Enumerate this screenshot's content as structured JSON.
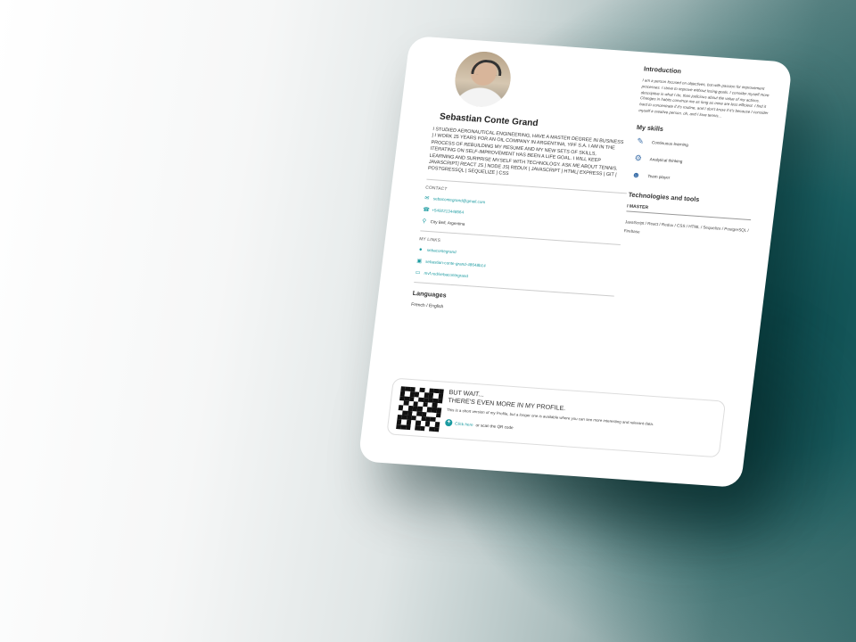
{
  "profile": {
    "name": "Sebastian Conte Grand",
    "bio": "I STUDIED AERONAUTICAL ENGINEERING, HAVE A MASTER DEGREE IN BUSINESS | I WORK 25 YEARS FOR AN OIL COMPANY IN ARGENTINA, YPF S.A. I AM IN THE PROCESS OF REBUILDING MY RESUME AND MY NEW SETS OF SKILLS, ITERATING ON SELF-IMPROVEMENT HAS BEEN A LIFE GOAL. I WILL KEEP LEARNING AND SURPRISE MYSELF WITH TECHNOLOGY. ASK ME ABOUT TENNIS. JAVASCRIPT| REACT JS | NODE JS| REDUX | JAVASCRIPT | HTML| EXPRESS | GIT | POSTGRESSQL | SEQUELIZE | CSS"
  },
  "contact": {
    "label": "CONTACT",
    "email": "sebacontegrand@gmail.com",
    "phone": "+5492213448564",
    "location": "City Bell, Argentina"
  },
  "links": {
    "label": "MY LINKS",
    "github": "sebacontegrand",
    "linkedin": "sebastian-conte-grand-48648b14",
    "other": "mvf.red/sebacontegrand"
  },
  "languages": {
    "title": "Languages",
    "list": "French / English"
  },
  "intro": {
    "title": "Introduction",
    "text": "I am a person focused on objectives, but with passion for improvement processes. I strive to improve without losing goals. I consider myself more descriptive in what I do, than judicious about the value of my actions. Changes in habits convince me as long as mine are less efficient. I find it hard to concentrate if it's routine, and I don't know if it's because I consider myself a creative person. oh, and I love tennis..."
  },
  "skills": {
    "title": "My skills",
    "items": [
      {
        "label": "Continuous learning",
        "icon": "learning-icon"
      },
      {
        "label": "Analytical thinking",
        "icon": "analytics-icon"
      },
      {
        "label": "Team player",
        "icon": "team-icon"
      }
    ]
  },
  "tech": {
    "title": "Technologies and tools",
    "level": "I MASTER",
    "list": "JavaScript / React / Redux / CSS / HTML / Sequelize / PostgreSQL / Firebase"
  },
  "promo": {
    "title_line1": "BUT WAIT...",
    "title_line2": "THERE'S EVEN MORE IN MY PROFILE.",
    "sub": "This is a short version of my Profile, but a longer one is available where you can see more interesting and relevant data.",
    "cta_link": "Click here",
    "cta_rest": " or scan the QR code"
  },
  "colors": {
    "accent": "#1a9aa0",
    "background_dark": "#0f4d50"
  }
}
